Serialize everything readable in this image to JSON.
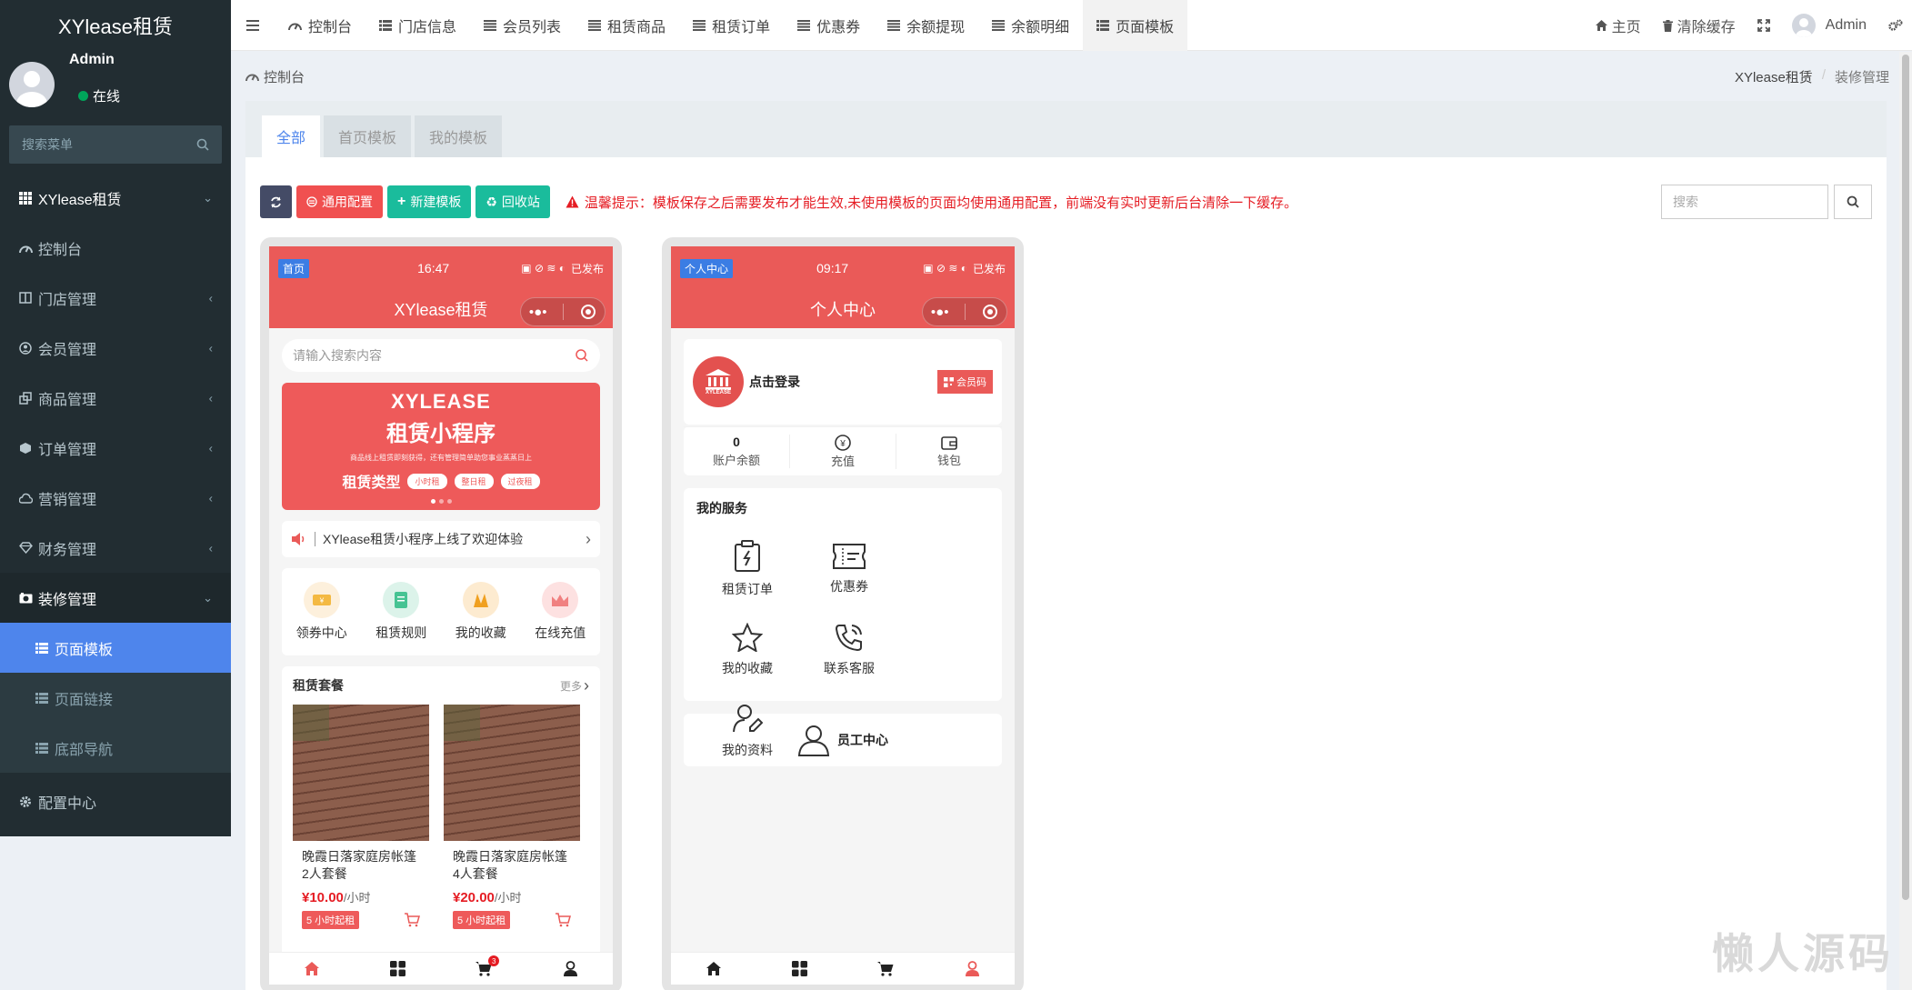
{
  "brand": "XYlease租赁",
  "user": {
    "name": "Admin",
    "status": "在线"
  },
  "sidebar": {
    "search_placeholder": "搜索菜单",
    "items": [
      {
        "label": "XYlease租赁"
      },
      {
        "label": "控制台"
      },
      {
        "label": "门店管理"
      },
      {
        "label": "会员管理"
      },
      {
        "label": "商品管理"
      },
      {
        "label": "订单管理"
      },
      {
        "label": "营销管理"
      },
      {
        "label": "财务管理"
      },
      {
        "label": "装修管理"
      },
      {
        "label": "页面模板"
      },
      {
        "label": "页面链接"
      },
      {
        "label": "底部导航"
      },
      {
        "label": "配置中心"
      }
    ]
  },
  "topbar": {
    "tabs": [
      "控制台",
      "门店信息",
      "会员列表",
      "租赁商品",
      "租赁订单",
      "优惠券",
      "余额提现",
      "余额明细",
      "页面模板"
    ],
    "home": "主页",
    "clear_cache": "清除缓存",
    "admin": "Admin"
  },
  "breadcrumb": {
    "left": "控制台",
    "root": "XYlease租赁",
    "current": "装修管理"
  },
  "panel_tabs": [
    "全部",
    "首页模板",
    "我的模板"
  ],
  "toolbar": {
    "general": "通用配置",
    "new_template": "新建模板",
    "recycle": "回收站",
    "warning": "温馨提示：模板保存之后需要发布才能生效,未使用模板的页面均使用通用配置，前端没有实时更新后台清除一下缓存。",
    "search_placeholder": "搜索"
  },
  "phone1": {
    "tag": "首页",
    "time": "16:47",
    "published": "已发布",
    "title": "XYlease租赁",
    "search_placeholder": "请输入搜索内容",
    "banner": {
      "line1": "XYLEASE",
      "line2": "租赁小程序",
      "line3": "商品线上租赁即刻获得，还有管理简单助您事业蒸蒸日上",
      "type_label": "租赁类型",
      "pills": [
        "小时租",
        "整日租",
        "过夜租"
      ]
    },
    "notice": "XYlease租赁小程序上线了欢迎体验",
    "quick": [
      "领券中心",
      "租赁规则",
      "我的收藏",
      "在线充值"
    ],
    "pkg_title": "租赁套餐",
    "more": "更多",
    "products": [
      {
        "title": "晚霞日落家庭房帐篷2人套餐",
        "price": "¥10.00",
        "unit": "/小时",
        "min": "5 小时起租"
      },
      {
        "title": "晚霞日落家庭房帐篷4人套餐",
        "price": "¥20.00",
        "unit": "/小时",
        "min": "5 小时起租"
      }
    ],
    "cart_badge": "3"
  },
  "phone2": {
    "tag": "个人中心",
    "time": "09:17",
    "published": "已发布",
    "title": "个人中心",
    "logo_text": "XYLEASE",
    "login": "点击登录",
    "vip": "会员码",
    "balance": "0",
    "balance_label": "账户余额",
    "recharge": "充值",
    "wallet": "钱包",
    "services_title": "我的服务",
    "services": [
      "租赁订单",
      "优惠券",
      "我的收藏",
      "联系客服",
      "我的资料"
    ],
    "staff": "员工中心"
  },
  "watermark": "懒人源码",
  "colors": {
    "sidebar": "#222d32",
    "active": "#4e85ec",
    "phone_red": "#ea5a58",
    "teal": "#1abc9c"
  }
}
